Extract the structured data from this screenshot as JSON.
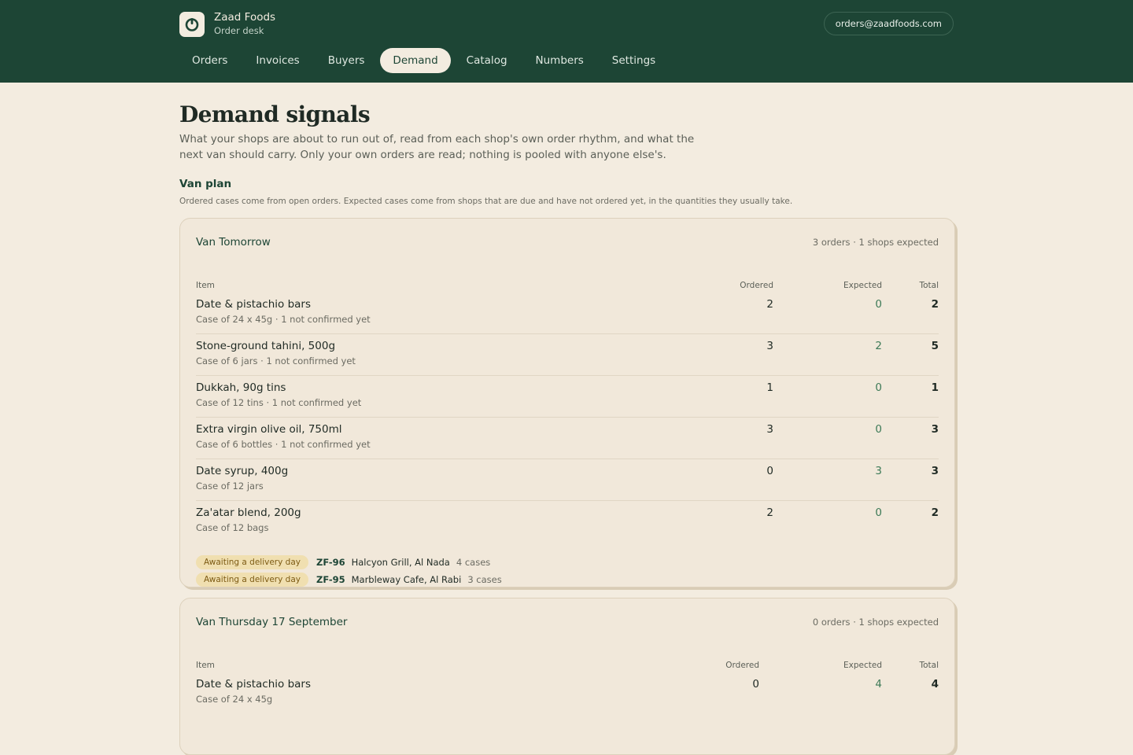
{
  "brand": {
    "name": "Zaad Foods",
    "subtitle": "Order desk"
  },
  "account": {
    "email": "orders@zaadfoods.com"
  },
  "nav": [
    {
      "label": "Orders",
      "active": false
    },
    {
      "label": "Invoices",
      "active": false
    },
    {
      "label": "Buyers",
      "active": false
    },
    {
      "label": "Demand",
      "active": true
    },
    {
      "label": "Catalog",
      "active": false
    },
    {
      "label": "Numbers",
      "active": false
    },
    {
      "label": "Settings",
      "active": false
    }
  ],
  "page": {
    "title": "Demand signals",
    "description": "What your shops are about to run out of, read from each shop's own order rhythm, and what the next van should carry. Only your own orders are read; nothing is pooled with anyone else's."
  },
  "van_plan": {
    "title": "Van plan",
    "description": "Ordered cases come from open orders. Expected cases come from shops that are due and have not ordered yet, in the quantities they usually take."
  },
  "columns": {
    "item": "Item",
    "ordered": "Ordered",
    "expected": "Expected",
    "total": "Total"
  },
  "vans": [
    {
      "title": "Van Tomorrow",
      "meta": "3 orders · 1 shops expected",
      "rows": [
        {
          "name": "Date & pistachio bars",
          "sub": "Case of 24 x 45g · 1 not confirmed yet",
          "ordered": "2",
          "expected": "0",
          "total": "2"
        },
        {
          "name": "Stone-ground tahini, 500g",
          "sub": "Case of 6 jars · 1 not confirmed yet",
          "ordered": "3",
          "expected": "2",
          "total": "5"
        },
        {
          "name": "Dukkah, 90g tins",
          "sub": "Case of 12 tins · 1 not confirmed yet",
          "ordered": "1",
          "expected": "0",
          "total": "1"
        },
        {
          "name": "Extra virgin olive oil, 750ml",
          "sub": "Case of 6 bottles · 1 not confirmed yet",
          "ordered": "3",
          "expected": "0",
          "total": "3"
        },
        {
          "name": "Date syrup, 400g",
          "sub": "Case of 12 jars",
          "ordered": "0",
          "expected": "3",
          "total": "3"
        },
        {
          "name": "Za'atar blend, 200g",
          "sub": "Case of 12 bags",
          "ordered": "2",
          "expected": "0",
          "total": "2"
        }
      ],
      "pending": [
        {
          "badge": "Awaiting a delivery day",
          "code": "ZF-96",
          "shop": "Halcyon Grill, Al Nada",
          "cases": "4 cases"
        },
        {
          "badge": "Awaiting a delivery day",
          "code": "ZF-95",
          "shop": "Marbleway Cafe, Al Rabi",
          "cases": "3 cases"
        }
      ]
    },
    {
      "title": "Van Thursday 17 September",
      "meta": "0 orders · 1 shops expected",
      "rows": [
        {
          "name": "Date & pistachio bars",
          "sub": "Case of 24 x 45g",
          "ordered": "0",
          "expected": "4",
          "total": "4"
        }
      ]
    }
  ],
  "colors": {
    "header": "#1d4535",
    "background": "#f3ece0",
    "card": "#f1e8da",
    "accent_green": "#3d7a57",
    "badge": "#f0dfb0"
  }
}
